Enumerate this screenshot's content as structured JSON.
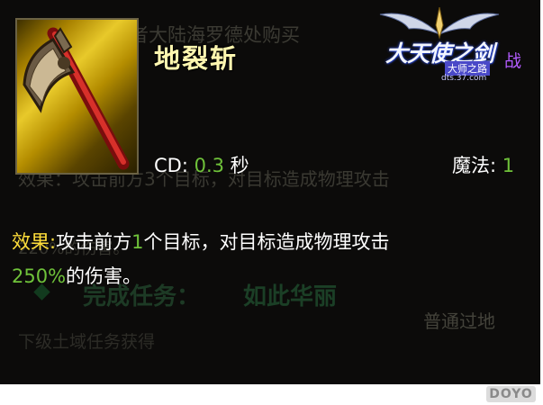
{
  "background_text": {
    "line_1": "获得途径：勇者大陆海罗德处购买",
    "line_2": "效果：攻击前方3个目标，对目标造成物理攻击",
    "line_3": "220%的伤害。",
    "line_4": "普通过地",
    "task_label": "完成任务：",
    "task_value": "如此华丽",
    "bottom_tip": "下级土域任务获得"
  },
  "tooltip": {
    "skill_name": "地裂斩",
    "cd_label": "CD: ",
    "cd_value": "0.3",
    "cd_unit": " 秒",
    "mana_label": "魔法: ",
    "mana_value": "1",
    "effect_label": "效果:",
    "effect_text_1": "攻击前方",
    "effect_target_count": "1",
    "effect_text_2": "个目标，对目标造成物理攻击",
    "damage_percent": "250%",
    "effect_text_3": "的伤害。"
  },
  "logo": {
    "title": "大天使之剑",
    "subtitle": "大师之路",
    "url": "dts.37.com",
    "class_text": "战"
  },
  "watermark": "DOYO",
  "colors": {
    "highlight_green": "#6fc23a",
    "label_yellow": "#ffde3a",
    "name_yellow": "#fff7b0",
    "panel_bg": "#0c0b0a"
  },
  "icon": "axe-icon"
}
